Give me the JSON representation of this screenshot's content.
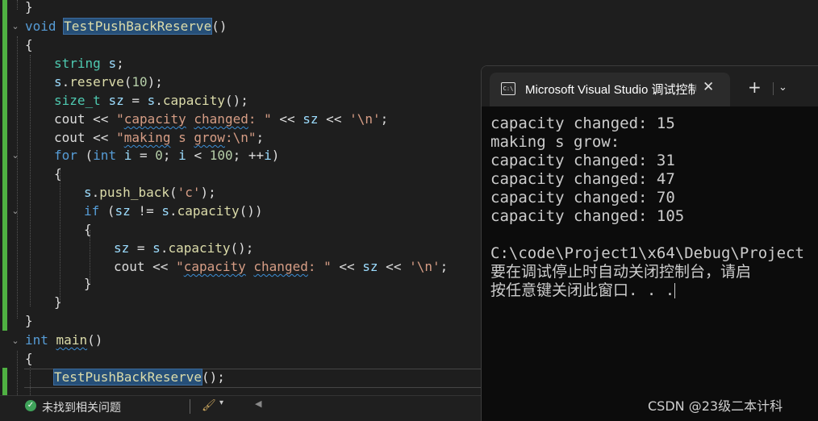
{
  "editor": {
    "l0": {
      "brace": "}"
    },
    "l1": {
      "kw_void": "void",
      "fn_name": "TestPushBackReserve",
      "parens": "()"
    },
    "l2": {
      "brace": "{"
    },
    "l3": {
      "type": "string",
      "sp": " ",
      "var": "s",
      "semi": ";"
    },
    "l4": {
      "var": "s",
      "dot": ".",
      "fn": "reserve",
      "p1": "(",
      "num": "10",
      "p2": ");"
    },
    "l5": {
      "type": "size_t",
      "sp": " ",
      "var": "sz",
      "eq": " = ",
      "var2": "s",
      "dot": ".",
      "fn": "capacity",
      "p": "();"
    },
    "l6": {
      "id": "cout",
      "op": " << ",
      "q1": "\"",
      "s1": "capacity",
      "sp": " ",
      "s2": "changed",
      "s3": ": \"",
      "op2": " << ",
      "var": "sz",
      "op3": " << ",
      "chr": "'\\n'",
      "semi": ";"
    },
    "l7": {
      "id": "cout",
      "op": " << ",
      "q1": "\"",
      "s1": "making",
      "s2": " s ",
      "s3": "grow",
      "s4": ":\\n\"",
      "semi": ";"
    },
    "l8": {
      "kw": "for",
      "p1": " (",
      "type": "int",
      "sp": " ",
      "var": "i",
      "eq": " = ",
      "num": "0",
      "semi": "; ",
      "var2": "i",
      "lt": " < ",
      "num2": "100",
      "semi2": "; ",
      "inc": "++",
      "var3": "i",
      "p2": ")"
    },
    "l9": {
      "brace": "{"
    },
    "l10": {
      "var": "s",
      "dot": ".",
      "fn": "push_back",
      "p1": "(",
      "chr": "'c'",
      "p2": ");"
    },
    "l11": {
      "kw": "if",
      "p1": " (",
      "var": "sz",
      "op": " != ",
      "var2": "s",
      "dot": ".",
      "fn": "capacity",
      "p2": "())"
    },
    "l12": {
      "brace": "{"
    },
    "l13": {
      "var": "sz",
      "eq": " = ",
      "var2": "s",
      "dot": ".",
      "fn": "capacity",
      "p": "();"
    },
    "l14": {
      "id": "cout",
      "op": " << ",
      "q1": "\"",
      "s1": "capacity",
      "sp": " ",
      "s2": "changed",
      "s3": ": \"",
      "op2": " << ",
      "var": "sz",
      "op3": " << ",
      "chr": "'\\n'",
      "semi": ";"
    },
    "l15": {
      "brace": "}"
    },
    "l16": {
      "brace": "}"
    },
    "l17": {
      "brace": "}"
    },
    "l18": {
      "type": "int",
      "sp": " ",
      "fn": "main",
      "parens": "()"
    },
    "l19": {
      "brace": "{"
    },
    "l20": {
      "fn": "TestPushBackReserve",
      "p": "();"
    }
  },
  "statusbar": {
    "status_text": "未找到相关问题",
    "check_glyph": "✓",
    "broom_glyph": "🖌",
    "dropdown_glyph": "▾",
    "scroll_left_glyph": "◀"
  },
  "terminal": {
    "icon_label": "C:\\",
    "tab_title": "Microsoft Visual Studio 调试控制台",
    "close_glyph": "✕",
    "new_tab_glyph": "+",
    "dropdown_glyph": "⌄",
    "lines": [
      "capacity changed: 15",
      "making s grow:",
      "capacity changed: 31",
      "capacity changed: 47",
      "capacity changed: 70",
      "capacity changed: 105",
      "",
      "C:\\code\\Project1\\x64\\Debug\\Project",
      "要在调试停止时自动关闭控制台，请启",
      "按任意键关闭此窗口. . ."
    ]
  },
  "watermark": "CSDN @23级二本计科",
  "colors": {
    "green_bar": "#4fb042",
    "keyword": "#569cd6",
    "type": "#4ec9b0",
    "function": "#dcdcaa",
    "variable": "#9cdcfe",
    "string": "#d69d85",
    "number": "#b5cea8"
  }
}
